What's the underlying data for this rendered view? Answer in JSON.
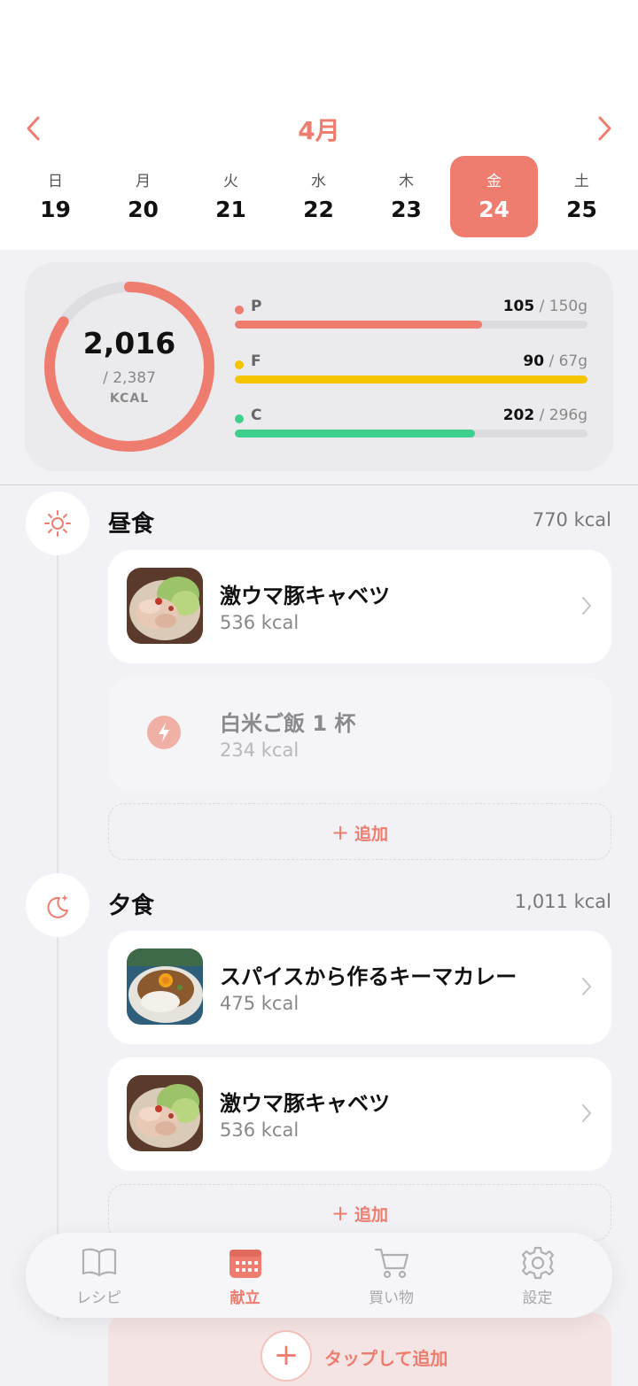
{
  "header": {
    "month": "4月",
    "days": [
      {
        "dow": "日",
        "num": "19",
        "selected": false
      },
      {
        "dow": "月",
        "num": "20",
        "selected": false
      },
      {
        "dow": "火",
        "num": "21",
        "selected": false
      },
      {
        "dow": "水",
        "num": "22",
        "selected": false
      },
      {
        "dow": "木",
        "num": "23",
        "selected": false
      },
      {
        "dow": "金",
        "num": "24",
        "selected": true
      },
      {
        "dow": "土",
        "num": "25",
        "selected": false
      }
    ]
  },
  "summary": {
    "kcal": "2,016",
    "goal": "/ 2,387",
    "unit": "KCAL",
    "progress": 0.845,
    "macros": [
      {
        "label": "P",
        "value": "105",
        "goal": "/ 150g",
        "fraction": 0.7,
        "color": "#ee7d6f"
      },
      {
        "label": "F",
        "value": "90",
        "goal": "/ 67g",
        "fraction": 1.0,
        "color": "#f5c400"
      },
      {
        "label": "C",
        "value": "202",
        "goal": "/ 296g",
        "fraction": 0.68,
        "color": "#3ecf8e"
      }
    ]
  },
  "lunch": {
    "title": "昼食",
    "kcal": "770 kcal",
    "items": [
      {
        "name": "激ウマ豚キャベツ",
        "kcal": "536 kcal"
      },
      {
        "name": "白米ご飯 1 杯",
        "kcal": "234 kcal"
      }
    ],
    "add": "追加"
  },
  "dinner": {
    "title": "夕食",
    "kcal": "1,011 kcal",
    "items": [
      {
        "name": "スパイスから作るキーマカレー",
        "kcal": "475 kcal"
      },
      {
        "name": "激ウマ豚キャベツ",
        "kcal": "536 kcal"
      }
    ],
    "add": "追加"
  },
  "tap_add": "タップして追加",
  "tabs": [
    {
      "label": "レシピ",
      "icon": "book-icon",
      "active": false
    },
    {
      "label": "献立",
      "icon": "calendar-icon",
      "active": true
    },
    {
      "label": "買い物",
      "icon": "cart-icon",
      "active": false
    },
    {
      "label": "設定",
      "icon": "gear-icon",
      "active": false
    }
  ],
  "colors": {
    "accent": "#ee7d6f",
    "background": "#f2f1f5"
  }
}
